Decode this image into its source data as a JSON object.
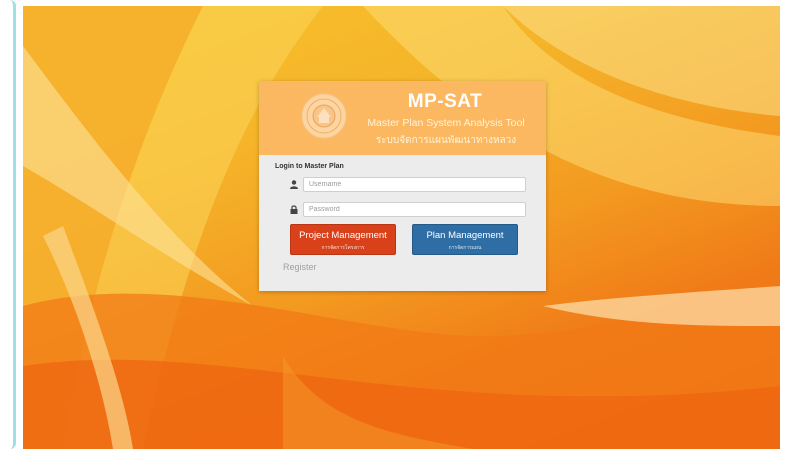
{
  "brand": {
    "title": "MP-SAT",
    "subtitle_en": "Master Plan System Analysis Tool",
    "subtitle_th": "ระบบจัดการแผนพัฒนาทางหลวง",
    "seal_icon": "department-seal-icon"
  },
  "login": {
    "heading": "Login to Master Plan",
    "username_placeholder": "Username",
    "password_placeholder": "Password",
    "user_icon": "user-icon",
    "lock_icon": "lock-icon"
  },
  "buttons": {
    "project_label": "Project Management",
    "project_sub": "การจัดการโครงการ",
    "plan_label": "Plan Management",
    "plan_sub": "การจัดการแผน"
  },
  "register_label": "Register",
  "colors": {
    "header_bg": "#fcb861",
    "project_button": "#d9411b",
    "plan_button": "#2f6ea5",
    "side_accent": "#9fe0e3"
  }
}
